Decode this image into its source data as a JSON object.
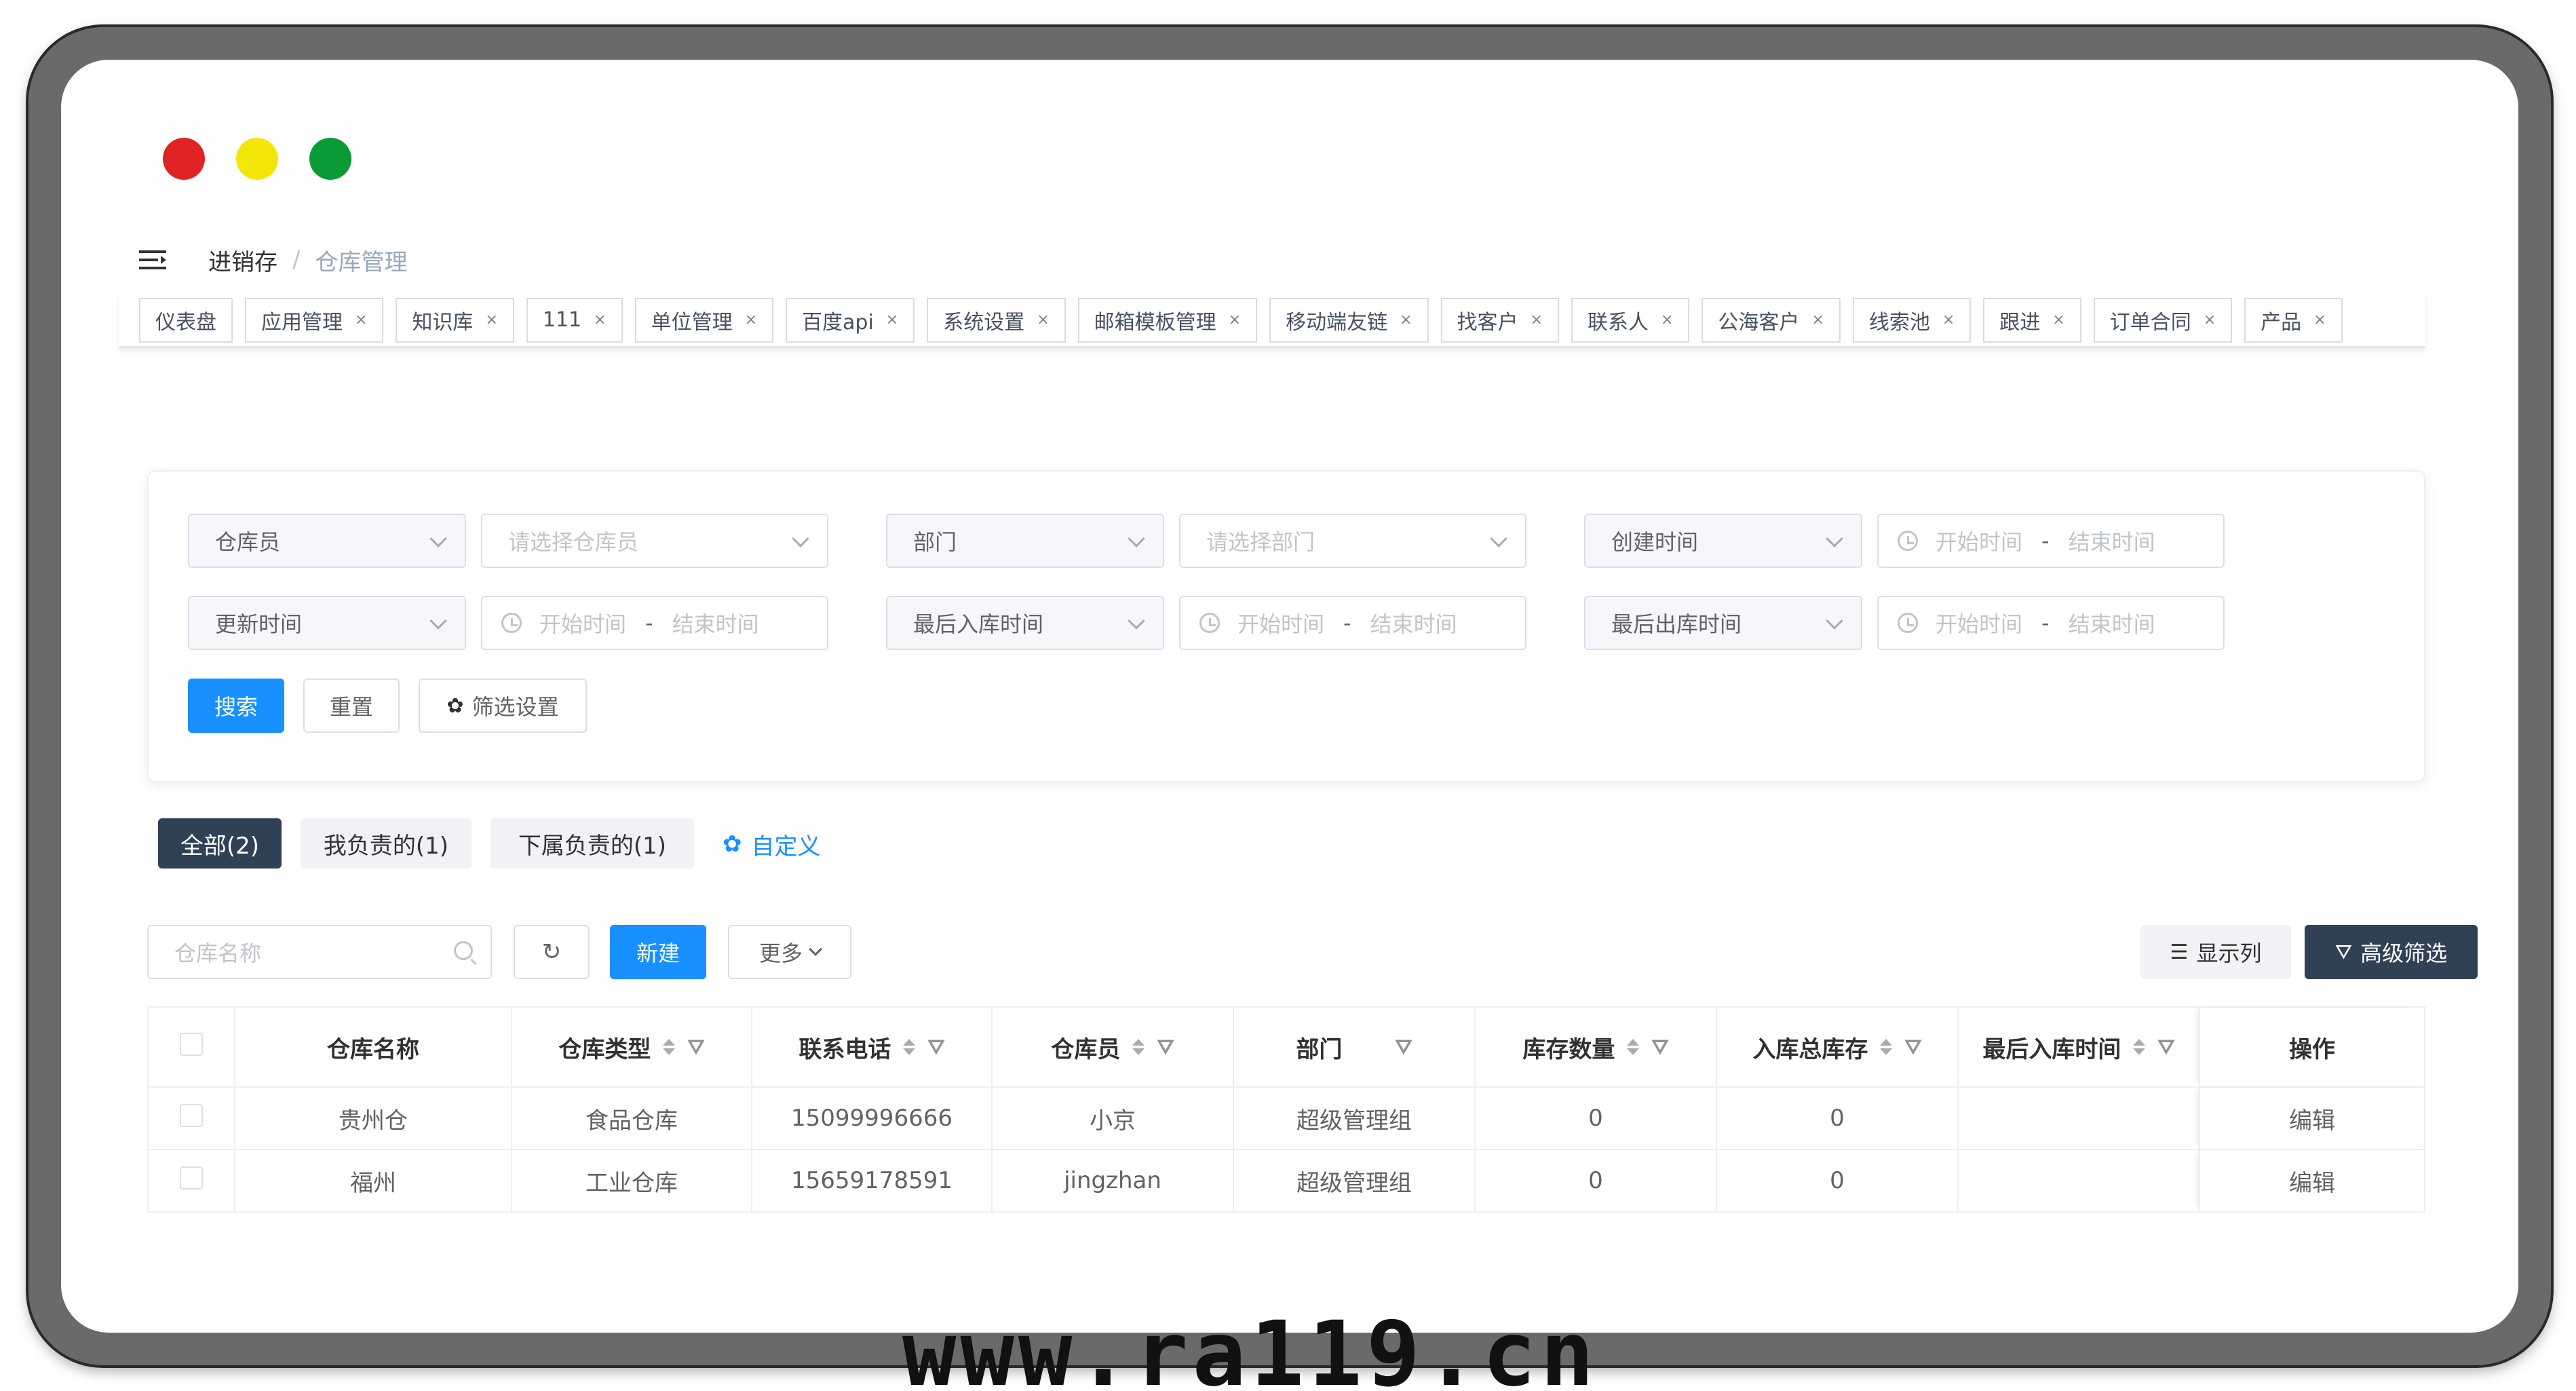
{
  "breadcrumb": {
    "parent": "进销存",
    "separator": "/",
    "current": "仓库管理"
  },
  "tags": [
    {
      "label": "仪表盘",
      "closable": false
    },
    {
      "label": "应用管理",
      "closable": true
    },
    {
      "label": "知识库",
      "closable": true
    },
    {
      "label": "111",
      "closable": true
    },
    {
      "label": "单位管理",
      "closable": true
    },
    {
      "label": "百度api",
      "closable": true
    },
    {
      "label": "系统设置",
      "closable": true
    },
    {
      "label": "邮箱模板管理",
      "closable": true
    },
    {
      "label": "移动端友链",
      "closable": true
    },
    {
      "label": "找客户",
      "closable": true
    },
    {
      "label": "联系人",
      "closable": true
    },
    {
      "label": "公海客户",
      "closable": true
    },
    {
      "label": "线索池",
      "closable": true
    },
    {
      "label": "跟进",
      "closable": true
    },
    {
      "label": "订单合同",
      "closable": true
    },
    {
      "label": "产品",
      "closable": true
    }
  ],
  "tag_close_glyph": "×",
  "filters": {
    "row1": [
      {
        "key": "仓库员",
        "value": "请选择仓库员",
        "kind": "select"
      },
      {
        "key": "部门",
        "value": "请选择部门",
        "kind": "select"
      },
      {
        "key": "创建时间",
        "start": "开始时间",
        "end": "结束时间",
        "kind": "daterange"
      }
    ],
    "row2": [
      {
        "key": "更新时间",
        "start": "开始时间",
        "end": "结束时间",
        "kind": "daterange"
      },
      {
        "key": "最后入库时间",
        "start": "开始时间",
        "end": "结束时间",
        "kind": "daterange"
      },
      {
        "key": "最后出库时间",
        "start": "开始时间",
        "end": "结束时间",
        "kind": "daterange"
      }
    ],
    "range_dash": "-",
    "search_label": "搜索",
    "reset_label": "重置",
    "settings_label": "筛选设置"
  },
  "scope_tabs": [
    {
      "label": "全部(2)",
      "active": true
    },
    {
      "label": "我负责的(1)",
      "active": false
    },
    {
      "label": "下属负责的(1)",
      "active": false
    }
  ],
  "custom_label": "自定义",
  "toolbar": {
    "search_placeholder": "仓库名称",
    "new_label": "新建",
    "more_label": "更多",
    "columns_label": "显示列",
    "advanced_label": "高级筛选"
  },
  "table": {
    "headers": [
      "仓库名称",
      "仓库类型",
      "联系电话",
      "仓库员",
      "部门",
      "库存数量",
      "入库总库存",
      "最后入库时间",
      "操作"
    ],
    "rows": [
      {
        "name": "贵州仓",
        "type": "食品仓库",
        "phone": "15099996666",
        "keeper": "小京",
        "dept": "超级管理组",
        "stock": "0",
        "total_in": "0",
        "last_in": "",
        "action": "编辑"
      },
      {
        "name": "福州",
        "type": "工业仓库",
        "phone": "15659178591",
        "keeper": "jingzhan",
        "dept": "超级管理组",
        "stock": "0",
        "total_in": "0",
        "last_in": "",
        "action": "编辑"
      }
    ]
  },
  "watermark": "www.ra119.cn",
  "colors": {
    "primary": "#1890ff",
    "dark": "#304156",
    "traffic_red": "#e02424",
    "traffic_yellow": "#f5e60a",
    "traffic_green": "#0a9b36"
  }
}
